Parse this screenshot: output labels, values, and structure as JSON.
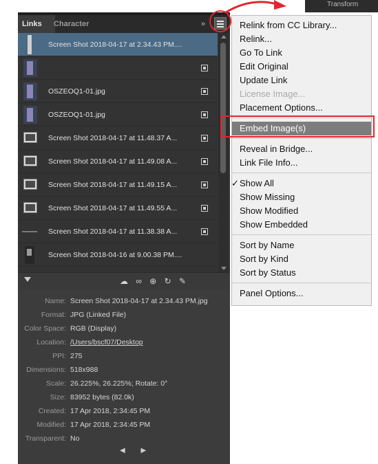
{
  "panel": {
    "tabs": [
      {
        "label": "Links"
      },
      {
        "label": "Character"
      }
    ],
    "collapse_glyph": "»",
    "menu_icon": "hamburger-menu-icon",
    "links": [
      {
        "name": "Screen Shot 2018-04-17 at 2.34.43 PM....",
        "thumb": "tall",
        "selected": true,
        "icon": false
      },
      {
        "name": "",
        "thumb": "dark",
        "selected": false,
        "icon": true
      },
      {
        "name": "OSZEOQ1-01.jpg",
        "thumb": "dark",
        "selected": false,
        "icon": true
      },
      {
        "name": "OSZEOQ1-01.jpg",
        "thumb": "dark",
        "selected": false,
        "icon": true
      },
      {
        "name": "Screen Shot 2018-04-17 at 11.48.37 A...",
        "thumb": "screen",
        "selected": false,
        "icon": true
      },
      {
        "name": "Screen Shot 2018-04-17 at 11.49.08 A...",
        "thumb": "screen",
        "selected": false,
        "icon": true
      },
      {
        "name": "Screen Shot 2018-04-17 at 11.49.15 A...",
        "thumb": "screen",
        "selected": false,
        "icon": true
      },
      {
        "name": "Screen Shot 2018-04-17 at 11.49.55 A...",
        "thumb": "screen",
        "selected": false,
        "icon": true
      },
      {
        "name": "Screen Shot 2018-04-17 at 11.38.38 A...",
        "thumb": "thin",
        "selected": false,
        "icon": true
      },
      {
        "name": "Screen Shot 2018-04-16 at 9.00.38 PM....",
        "thumb": "doc",
        "selected": false,
        "icon": false
      }
    ],
    "toolbar": {
      "icons": [
        "cc-library-icon",
        "relink-icon",
        "go-to-link-icon",
        "update-link-icon",
        "edit-original-icon"
      ],
      "glyphs": "☁ ∞ ⊕ ↻ ✎"
    },
    "info": [
      {
        "label": "Name:",
        "value": "Screen Shot 2018-04-17 at 2.34.43 PM.jpg"
      },
      {
        "label": "Format:",
        "value": "JPG (Linked File)"
      },
      {
        "label": "Color Space:",
        "value": "RGB (Display)"
      },
      {
        "label": "Location:",
        "value": "/Users/bscf07/Desktop"
      },
      {
        "label": "PPI:",
        "value": "275"
      },
      {
        "label": "Dimensions:",
        "value": "518x988"
      },
      {
        "label": "Scale:",
        "value": "26.225%, 26.225%; Rotate: 0°"
      },
      {
        "label": "Size:",
        "value": "83952 bytes (82.0k)"
      },
      {
        "label": "Created:",
        "value": "17 Apr 2018, 2:34:45 PM"
      },
      {
        "label": "Modified:",
        "value": "17 Apr 2018, 2:34:45 PM"
      },
      {
        "label": "Transparent:",
        "value": "No"
      }
    ],
    "nav_arrows": "◀ ▶"
  },
  "top_right_label": "Transform",
  "menu": {
    "groups": [
      [
        {
          "label": "Relink from CC Library..."
        },
        {
          "label": "Relink..."
        },
        {
          "label": "Go To Link"
        },
        {
          "label": "Edit Original"
        },
        {
          "label": "Update Link"
        },
        {
          "label": "License Image...",
          "disabled": true
        },
        {
          "label": "Placement Options..."
        }
      ],
      [
        {
          "label": "Embed Image(s)",
          "highlighted": true
        }
      ],
      [
        {
          "label": "Reveal in Bridge..."
        },
        {
          "label": "Link File Info..."
        }
      ],
      [
        {
          "label": "Show All",
          "checked": true
        },
        {
          "label": "Show Missing"
        },
        {
          "label": "Show Modified"
        },
        {
          "label": "Show Embedded"
        }
      ],
      [
        {
          "label": "Sort by Name"
        },
        {
          "label": "Sort by Kind"
        },
        {
          "label": "Sort by Status"
        }
      ],
      [
        {
          "label": "Panel Options..."
        }
      ]
    ]
  },
  "colors": {
    "panel_bg": "#3c3c3c",
    "selection": "#4b6a86",
    "menu_bg": "#f0f0f0",
    "menu_highlight": "#7d7d7d",
    "annotation": "#e3262c"
  }
}
